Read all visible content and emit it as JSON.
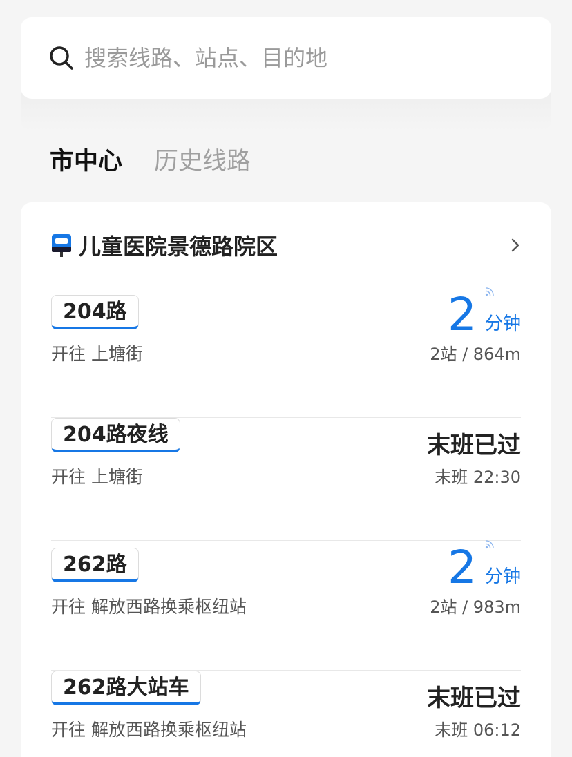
{
  "search": {
    "placeholder": "搜索线路、站点、目的地"
  },
  "tabs": [
    {
      "label": "市中心",
      "active": true
    },
    {
      "label": "历史线路",
      "active": false
    }
  ],
  "station": {
    "name": "儿童医院景德路院区"
  },
  "routes": [
    {
      "name": "204路",
      "destination": "开往 上塘街",
      "eta_value": "2",
      "eta_unit": "分钟",
      "detail": "2站 / 864m"
    },
    {
      "name": "204路夜线",
      "destination": "开往 上塘街",
      "status": "末班已过",
      "detail": "末班 22:30"
    },
    {
      "name": "262路",
      "destination": "开往 解放西路换乘枢纽站",
      "eta_value": "2",
      "eta_unit": "分钟",
      "detail": "2站 / 983m"
    },
    {
      "name": "262路大站车",
      "destination": "开往 解放西路换乘枢纽站",
      "status": "末班已过",
      "detail": "末班 06:12"
    }
  ],
  "colors": {
    "accent": "#1677e5",
    "background": "#f5f5f5"
  }
}
